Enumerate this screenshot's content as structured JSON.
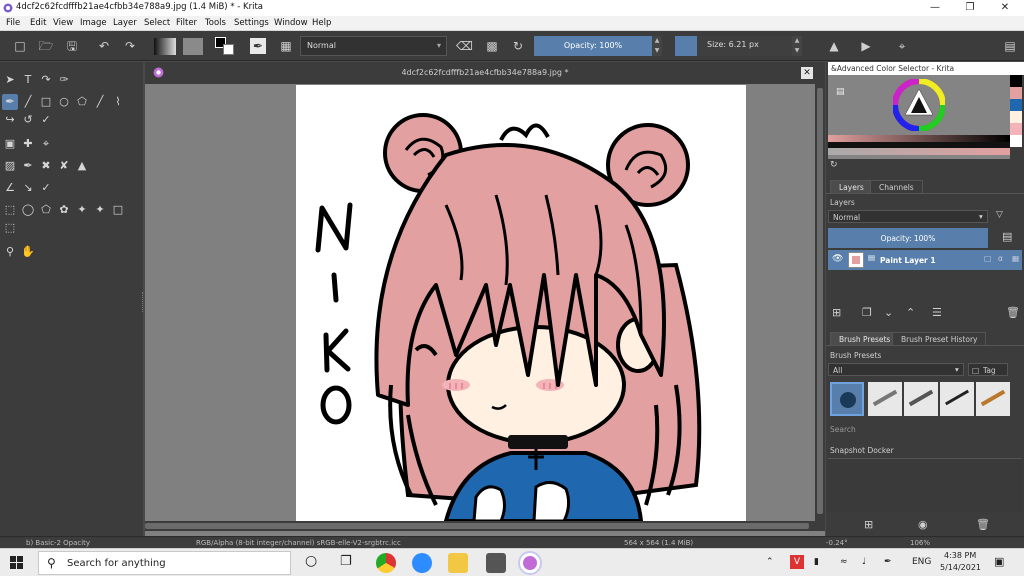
{
  "window": {
    "title": "4dcf2c62fcdfffb21ae4cfbb34e788a9.jpg (1.4 MiB)  * - Krita"
  },
  "menu": [
    "File",
    "Edit",
    "View",
    "Image",
    "Layer",
    "Select",
    "Filter",
    "Tools",
    "Settings",
    "Window",
    "Help"
  ],
  "toolbar": {
    "blend_mode": "Normal",
    "opacity": "Opacity: 100%",
    "size": "Size: 6.21 px"
  },
  "document": {
    "tab_title": "4dcf2c62fcdfffb21ae4cfbb34e788a9.jpg *"
  },
  "color_selector": {
    "title": "&Advanced Color Selector - Krita"
  },
  "layers_docker": {
    "tabs": [
      "Layers",
      "Channels"
    ],
    "label": "Layers",
    "blend_mode": "Normal",
    "opacity": "Opacity:  100%",
    "layer_name": "Paint Layer 1"
  },
  "brush_presets": {
    "tabs": [
      "Brush Presets",
      "Brush Preset History"
    ],
    "label": "Brush Presets",
    "filter": "All",
    "tag": "Tag",
    "search_placeholder": "Search"
  },
  "snapshot": {
    "label": "Snapshot Docker"
  },
  "statusbar": {
    "brush": "b) Basic-2 Opacity",
    "color_info": "RGB/Alpha (8-bit integer/channel)  sRGB-elle-V2-srgbtrc.icc",
    "image_info": "564 x 564 (1.4 MiB)",
    "rotation": "-0.24°",
    "zoom": "106%"
  },
  "taskbar": {
    "search_placeholder": "Search for anything",
    "lang": "ENG",
    "time": "4:38 PM",
    "date": "5/14/2021"
  },
  "colors": {
    "hair": "#e3a0a0",
    "outline": "#000000",
    "skin": "#fff0e2",
    "cheek": "#f4b3b8",
    "jacket": "#1f68b0",
    "accent": "#587fab"
  },
  "drawing": {
    "letters": [
      "N",
      "I",
      "K",
      "O"
    ]
  }
}
